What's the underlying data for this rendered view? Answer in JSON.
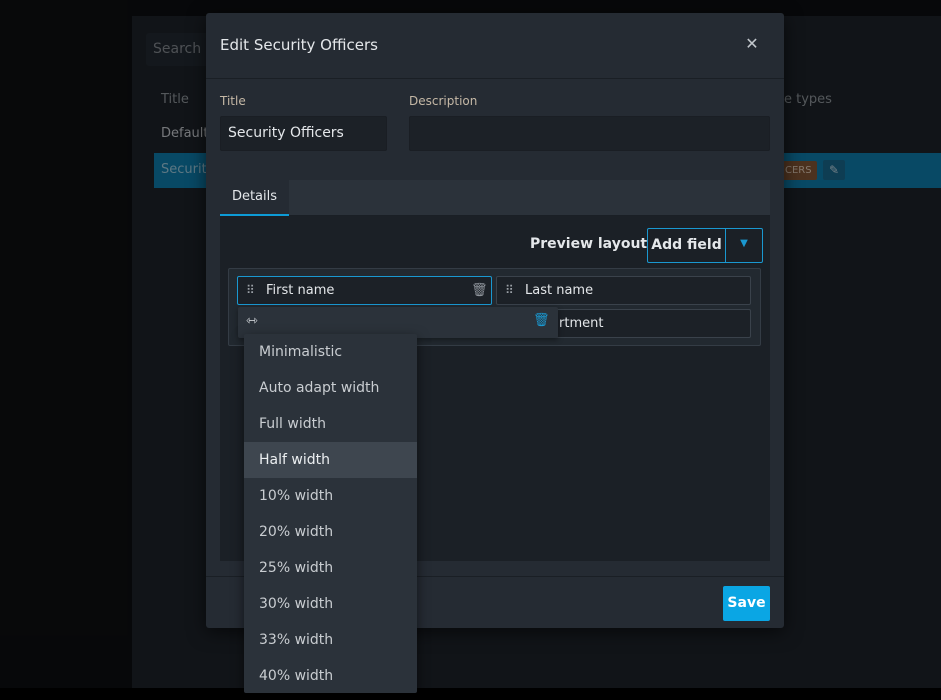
{
  "background": {
    "search_placeholder": "Search",
    "column_title": "Title",
    "column_types": "e types",
    "row_default": "Default",
    "row_selected": "Security",
    "tag_text": "CERS"
  },
  "modal": {
    "title": "Edit Security Officers",
    "title_label": "Title",
    "title_value": "Security Officers",
    "description_label": "Description",
    "description_value": "",
    "tab_details": "Details",
    "preview_layout": "Preview layout",
    "add_field": "Add field",
    "fields": {
      "first_name": "First name",
      "last_name": "Last name",
      "department_partial": "rtment"
    },
    "save": "Save"
  },
  "width_menu": {
    "selected": "Half width",
    "options": [
      "Minimalistic",
      "Auto adapt width",
      "Full width",
      "Half width",
      "10% width",
      "20% width",
      "25% width",
      "30% width",
      "33% width",
      "40% width"
    ]
  },
  "colors": {
    "accent": "#0aa6e4",
    "selected_row": "#0f86b8",
    "modal_bg": "#252b33"
  }
}
